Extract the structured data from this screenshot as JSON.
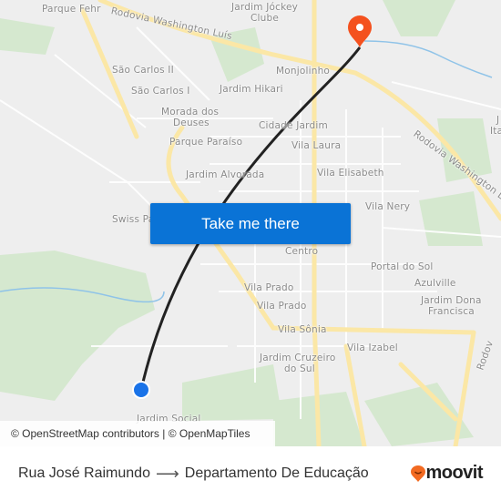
{
  "map": {
    "labels": [
      "Parque Fehr",
      "Rodovia Washington Luís",
      "Jardim Jóckey",
      "Clube",
      "São Carlos II",
      "São Carlos I",
      "Monjolinho",
      "Jardim Hikari",
      "Morada dos",
      "Deuses",
      "Parque Paraíso",
      "Cidade Jardim",
      "Vila Laura",
      "Rodovia Washington Luís",
      "Jardim Alvorada",
      "Vila Elisabeth",
      "Swiss Pa",
      "Vila Nery",
      "Centro",
      "Portal do Sol",
      "Azulville",
      "Vila Prado",
      "Vila Prado",
      "Jardim Dona",
      "Francisca",
      "Vila Sônia",
      "Vila Izabel",
      "Jardim Cruzeiro",
      "do Sul",
      "Jardim Social",
      "J",
      "Ita",
      "Rodov"
    ],
    "route_color": "#222222",
    "origin_color": "#1a73e8",
    "destination_color": "#f4511e",
    "origin_icon": "origin-dot-icon",
    "destination_icon": "destination-pin-icon"
  },
  "cta": {
    "label": "Take me there",
    "color": "#0a73d6"
  },
  "attribution": "© OpenStreetMap contributors | © OpenMapTiles",
  "footer": {
    "from": "Rua José Raimundo",
    "arrow_icon": "arrow-right-icon",
    "to": "Departamento De Educação",
    "logo_text": "moovit",
    "logo_color": "#f26a21"
  }
}
